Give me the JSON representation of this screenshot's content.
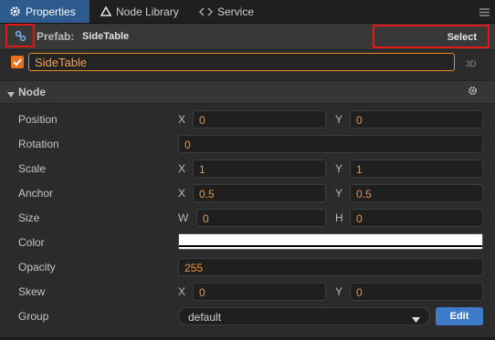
{
  "tabs": [
    {
      "label": "Properties",
      "icon": "gear-icon",
      "active": true
    },
    {
      "label": "Node Library",
      "icon": "triangle-icon",
      "active": false
    },
    {
      "label": "Service",
      "icon": "service-icon",
      "active": false
    }
  ],
  "prefab": {
    "label": "Prefab:",
    "name": "SideTable",
    "select_label": "Select"
  },
  "node": {
    "enabled": true,
    "name": "SideTable",
    "tag": "3D"
  },
  "section": {
    "title": "Node"
  },
  "properties": {
    "position": {
      "label": "Position",
      "x_axis": "X",
      "x": "0",
      "y_axis": "Y",
      "y": "0"
    },
    "rotation": {
      "label": "Rotation",
      "value": "0"
    },
    "scale": {
      "label": "Scale",
      "x_axis": "X",
      "x": "1",
      "y_axis": "Y",
      "y": "1"
    },
    "anchor": {
      "label": "Anchor",
      "x_axis": "X",
      "x": "0.5",
      "y_axis": "Y",
      "y": "0.5"
    },
    "size": {
      "label": "Size",
      "w_axis": "W",
      "w": "0",
      "h_axis": "H",
      "h": "0"
    },
    "color": {
      "label": "Color",
      "value": "#ffffff"
    },
    "opacity": {
      "label": "Opacity",
      "value": "255"
    },
    "skew": {
      "label": "Skew",
      "x_axis": "X",
      "x": "0",
      "y_axis": "Y",
      "y": "0"
    },
    "group": {
      "label": "Group",
      "value": "default",
      "edit_label": "Edit"
    }
  },
  "colors": {
    "accent": "#e8731e",
    "tab_active": "#2d5b8e",
    "highlight": "#e01818",
    "edit_button": "#3e7bc8"
  }
}
